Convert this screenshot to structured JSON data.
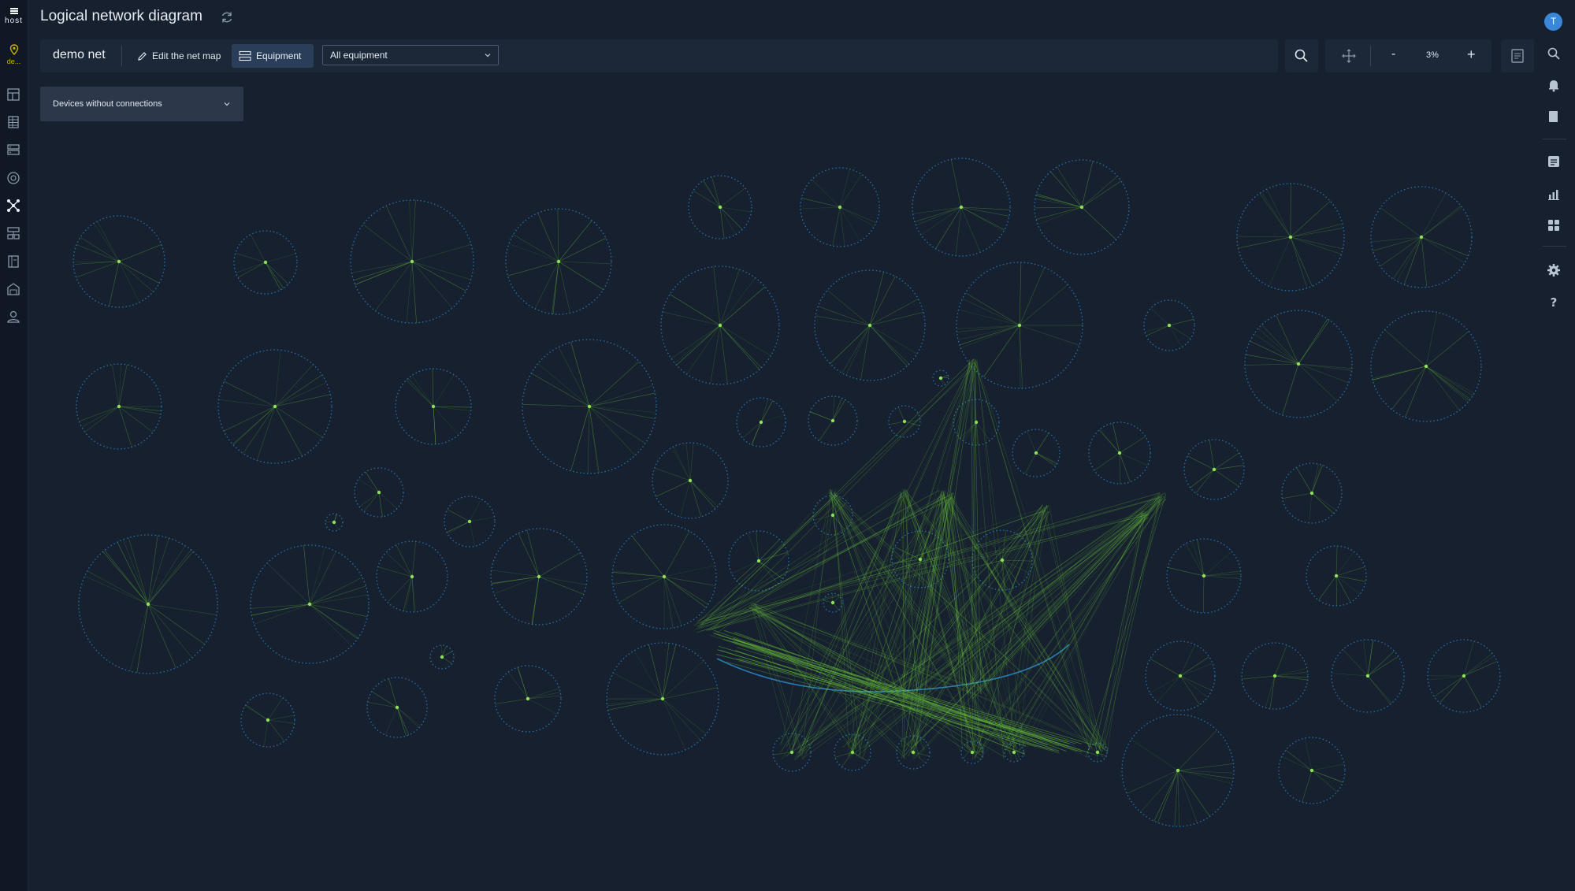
{
  "app": {
    "logo_text": "host",
    "location_label": "de..."
  },
  "header": {
    "title": "Logical network diagram"
  },
  "toolbar": {
    "net_name": "demo net",
    "edit_map_label": "Edit the net map",
    "equipment_label": "Equipment",
    "equipment_filter": "All equipment"
  },
  "zoom": {
    "out_label": "-",
    "level": "3%",
    "in_label": "+"
  },
  "filter_dropdown": {
    "label": "Devices without connections"
  },
  "user": {
    "avatar_initial": "T"
  },
  "left_nav": [
    "dashboard-icon",
    "table-icon",
    "server-rack-icon",
    "globe-icon",
    "network-map-icon",
    "devices-icon",
    "document-icon",
    "warehouse-icon",
    "user-icon"
  ],
  "right_nav": [
    "search-icon",
    "bell-icon",
    "book-icon",
    "list-icon",
    "chart-icon",
    "grid-icon",
    "gear-icon",
    "help-icon"
  ],
  "colors": {
    "background": "#16202e",
    "panel": "#1c2737",
    "node_ring": "#2a7fc0",
    "link": "#6ecb3c",
    "accent": "#3a87d8"
  }
}
